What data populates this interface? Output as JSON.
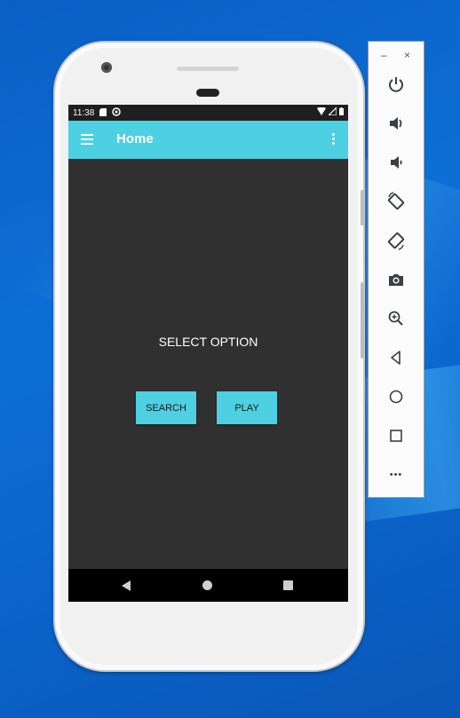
{
  "status_bar": {
    "time": "11:38"
  },
  "app_bar": {
    "title": "Home"
  },
  "content": {
    "label": "SELECT OPTION",
    "buttons": {
      "search": "SEARCH",
      "play": "PLAY"
    }
  },
  "emulator_toolbar": {
    "window_controls": {
      "minimize": "–",
      "close": "×"
    },
    "more_label": "•••",
    "items": [
      "power-icon",
      "volume-up-icon",
      "volume-down-icon",
      "rotate-left-icon",
      "rotate-right-icon",
      "camera-icon",
      "zoom-icon",
      "back-icon",
      "home-icon",
      "overview-icon",
      "more-icon"
    ]
  },
  "colors": {
    "accent": "#4dd0e1",
    "screen_bg": "#303030",
    "desktop_bg": "#0a63c9"
  }
}
